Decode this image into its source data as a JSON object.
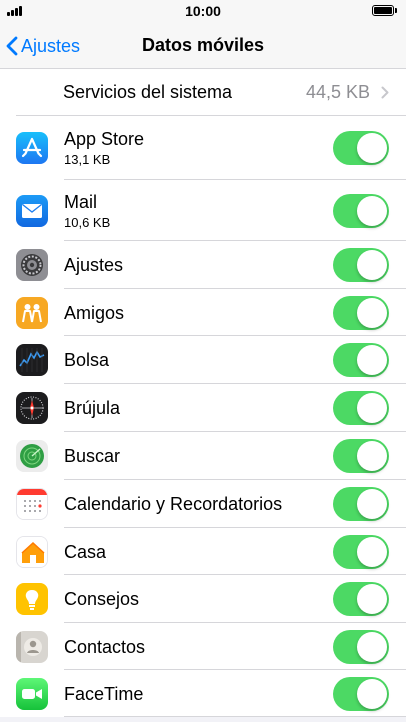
{
  "status_bar": {
    "time": "10:00"
  },
  "nav": {
    "back_label": "Ajustes",
    "title": "Datos móviles"
  },
  "system_services": {
    "label": "Servicios del sistema",
    "value": "44,5 KB"
  },
  "apps": [
    {
      "name": "App Store",
      "size": "13,1 KB",
      "icon": "app-store-icon",
      "enabled": true
    },
    {
      "name": "Mail",
      "size": "10,6 KB",
      "icon": "mail-icon",
      "enabled": true
    },
    {
      "name": "Ajustes",
      "size": "",
      "icon": "settings-icon",
      "enabled": true
    },
    {
      "name": "Amigos",
      "size": "",
      "icon": "friends-icon",
      "enabled": true
    },
    {
      "name": "Bolsa",
      "size": "",
      "icon": "stocks-icon",
      "enabled": true
    },
    {
      "name": "Brújula",
      "size": "",
      "icon": "compass-icon",
      "enabled": true
    },
    {
      "name": "Buscar",
      "size": "",
      "icon": "find-my-icon",
      "enabled": true
    },
    {
      "name": "Calendario y Recordatorios",
      "size": "",
      "icon": "calendar-icon",
      "enabled": true
    },
    {
      "name": "Casa",
      "size": "",
      "icon": "home-icon",
      "enabled": true
    },
    {
      "name": "Consejos",
      "size": "",
      "icon": "tips-icon",
      "enabled": true
    },
    {
      "name": "Contactos",
      "size": "",
      "icon": "contacts-icon",
      "enabled": true
    },
    {
      "name": "FaceTime",
      "size": "",
      "icon": "facetime-icon",
      "enabled": true
    }
  ],
  "colors": {
    "accent": "#007aff",
    "toggle_on": "#4cd964",
    "separator": "#d6d6da",
    "secondary_text": "#8e8e93"
  }
}
